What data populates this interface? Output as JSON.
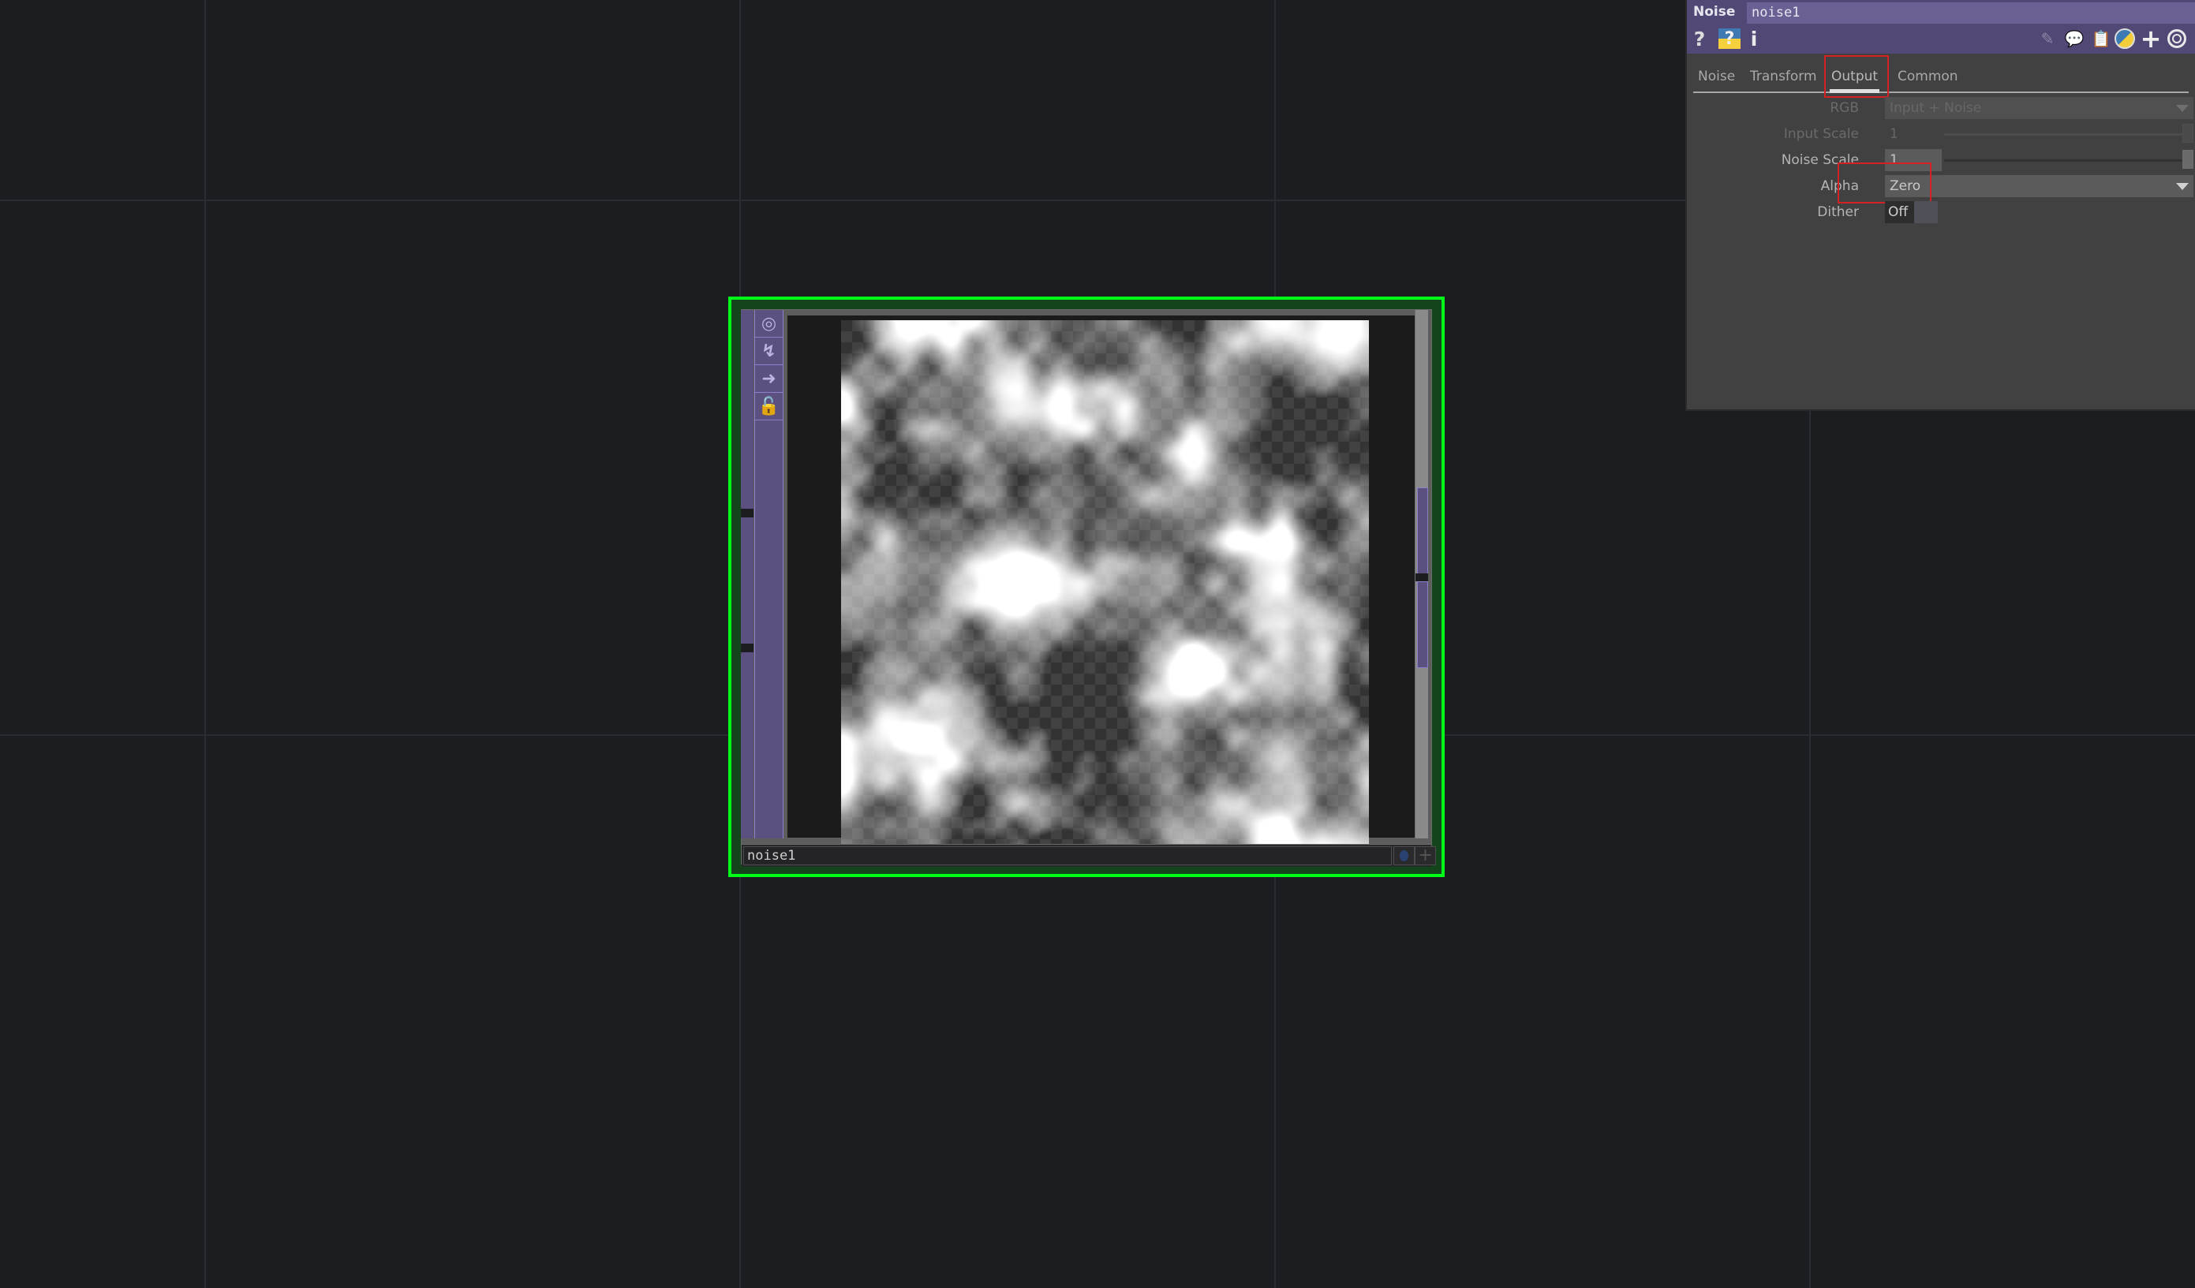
{
  "network": {
    "node": {
      "name": "noise1",
      "selected_color": "#00ff18",
      "toolbar_icons": [
        "viewer-toggle-icon",
        "cook-bolt-icon",
        "bypass-arrow-icon",
        "lock-icon"
      ],
      "viewer": {
        "content": "noise-preview",
        "alpha_checkerboard": true
      }
    }
  },
  "param_panel": {
    "op_type": "Noise",
    "op_name": "noise1",
    "header_icons_left": [
      "help-icon",
      "python-help-icon",
      "info-icon"
    ],
    "header_icons_right": [
      "edit-icon",
      "comment-icon",
      "clipboard-icon",
      "python-icon",
      "add-icon",
      "target-icon"
    ],
    "tabs": [
      {
        "label": "Noise",
        "active": false
      },
      {
        "label": "Transform",
        "active": false
      },
      {
        "label": "Output",
        "active": true
      },
      {
        "label": "Common",
        "active": false
      }
    ],
    "params": {
      "rgb": {
        "label": "RGB",
        "value": "Input + Noise",
        "enabled": false
      },
      "input_scale": {
        "label": "Input Scale",
        "value": "1",
        "slider_fraction": 1.0,
        "enabled": false
      },
      "noise_scale": {
        "label": "Noise Scale",
        "value": "1",
        "slider_fraction": 1.0,
        "enabled": true
      },
      "alpha": {
        "label": "Alpha",
        "value": "Zero",
        "enabled": true
      },
      "dither": {
        "label": "Dither",
        "value": "Off",
        "enabled": true
      }
    },
    "highlight_color": "#d42222"
  }
}
